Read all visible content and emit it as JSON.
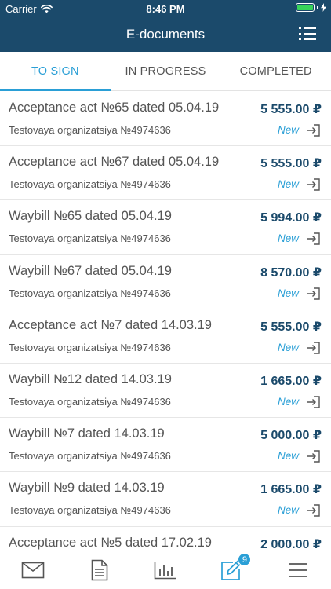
{
  "status_bar": {
    "carrier": "Carrier",
    "time": "8:46 PM"
  },
  "header": {
    "title": "E-documents",
    "filter_icon": "list-filter-icon"
  },
  "tabs": [
    {
      "label": "TO SIGN",
      "active": true
    },
    {
      "label": "IN PROGRESS",
      "active": false
    },
    {
      "label": "COMPLETED",
      "active": false
    }
  ],
  "documents": [
    {
      "title": "Acceptance act №65 dated 05.04.19",
      "amount": "5 555.00 ₽",
      "org": "Testovaya organizatsiya №4974636",
      "status": "New"
    },
    {
      "title": "Acceptance act №67 dated 05.04.19",
      "amount": "5 555.00 ₽",
      "org": "Testovaya organizatsiya №4974636",
      "status": "New"
    },
    {
      "title": "Waybill №65 dated 05.04.19",
      "amount": "5 994.00 ₽",
      "org": "Testovaya organizatsiya №4974636",
      "status": "New"
    },
    {
      "title": "Waybill №67 dated 05.04.19",
      "amount": "8 570.00 ₽",
      "org": "Testovaya organizatsiya №4974636",
      "status": "New"
    },
    {
      "title": "Acceptance act №7 dated 14.03.19",
      "amount": "5 555.00 ₽",
      "org": "Testovaya organizatsiya №4974636",
      "status": "New"
    },
    {
      "title": "Waybill №12 dated 14.03.19",
      "amount": "1 665.00 ₽",
      "org": "Testovaya organizatsiya №4974636",
      "status": "New"
    },
    {
      "title": "Waybill №7 dated 14.03.19",
      "amount": "5 000.00 ₽",
      "org": "Testovaya organizatsiya №4974636",
      "status": "New"
    },
    {
      "title": "Waybill №9 dated 14.03.19",
      "amount": "1 665.00 ₽",
      "org": "Testovaya organizatsiya №4974636",
      "status": "New"
    },
    {
      "title": "Acceptance act №5 dated 17.02.19",
      "amount": "2 000.00 ₽",
      "org": "",
      "status": ""
    }
  ],
  "tabbar": {
    "items": [
      {
        "icon": "mail-icon"
      },
      {
        "icon": "document-icon"
      },
      {
        "icon": "bar-chart-icon"
      },
      {
        "icon": "edit-sign-icon",
        "badge": "9",
        "active": true
      },
      {
        "icon": "menu-icon"
      }
    ]
  },
  "colors": {
    "header_bg": "#1b4a6b",
    "accent": "#2a9fd6",
    "amount": "#1b4a6b",
    "text": "#555555"
  }
}
